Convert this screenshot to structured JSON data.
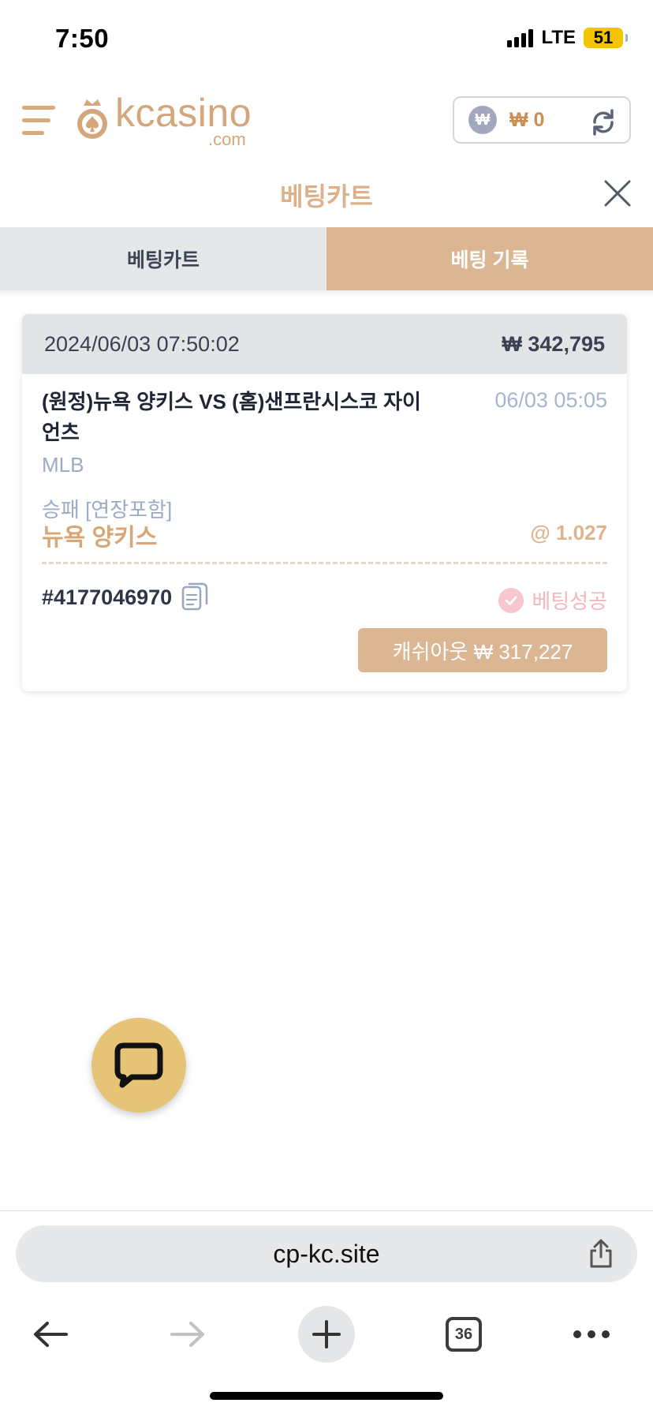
{
  "status_bar": {
    "time": "7:50",
    "network": "LTE",
    "battery": "51"
  },
  "header": {
    "logo_word": "kcasino",
    "logo_sub": ".com",
    "currency_symbol": "₩",
    "balance": "₩ 0"
  },
  "page": {
    "title": "베팅카트"
  },
  "tabs": [
    {
      "label": "베팅카트",
      "active": false
    },
    {
      "label": "베팅 기록",
      "active": true
    }
  ],
  "bet_card": {
    "datetime": "2024/06/03 07:50:02",
    "stake": "₩ 342,795",
    "match": "(원정)뉴욕 양키스 VS (홈)샌프란시스코 자이언츠",
    "match_time": "06/03 05:05",
    "league": "MLB",
    "market": "승패 [연장포함]",
    "pick": "뉴욕 양키스",
    "odds": "@ 1.027",
    "bet_id": "#4177046970",
    "status": "베팅성공",
    "cashout_label": "캐쉬아웃 ₩ 317,227"
  },
  "browser": {
    "url": "cp-kc.site",
    "tab_count": "36"
  },
  "colors": {
    "accent": "#dbb693",
    "title": "#dcb18a",
    "status_success": "#f3b5bf",
    "chat_button": "#e5c477"
  }
}
